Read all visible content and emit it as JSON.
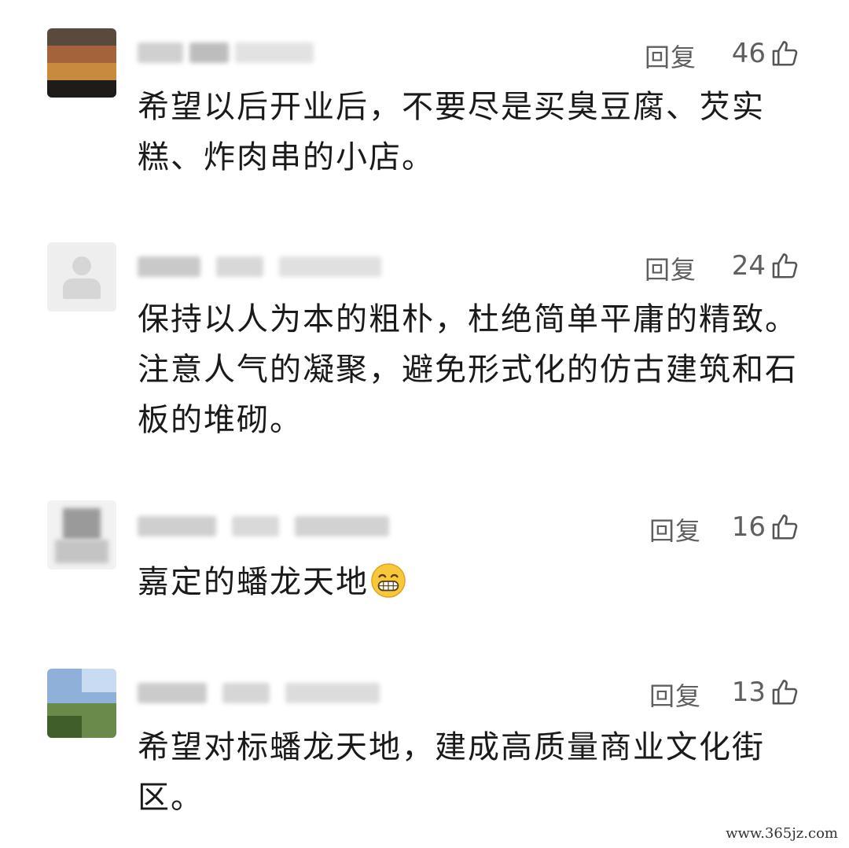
{
  "comments": [
    {
      "reply_label": "回复",
      "likes": "46",
      "text": "希望以后开业后，不要尽是买臭豆腐、芡实糕、炸肉串的小店。"
    },
    {
      "reply_label": "回复",
      "likes": "24",
      "text": "保持以人为本的粗朴，杜绝简单平庸的精致。注意人气的凝聚，避免形式化的仿古建筑和石板的堆砌。"
    },
    {
      "reply_label": "回复",
      "likes": "16",
      "text": "嘉定的蟠龙天地",
      "emoji": "grinning-face-emoji"
    },
    {
      "reply_label": "回复",
      "likes": "13",
      "text": "希望对标蟠龙天地，建成高质量商业文化街区。"
    }
  ],
  "icons": {
    "like": "thumbs-up-icon"
  },
  "watermark": "www.365jz.com"
}
